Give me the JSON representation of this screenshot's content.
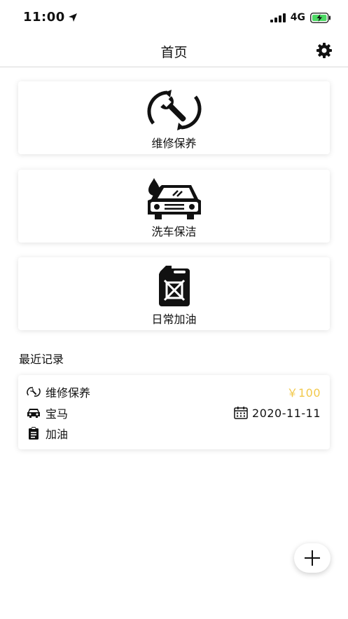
{
  "status_bar": {
    "time": "11:00",
    "network": "4G"
  },
  "nav": {
    "title": "首页",
    "settings_icon": "gear-icon"
  },
  "cards": [
    {
      "label": "维修保养",
      "icon": "wrench-cycle-icon"
    },
    {
      "label": "洗车保洁",
      "icon": "car-wash-icon"
    },
    {
      "label": "日常加油",
      "icon": "fuel-can-icon"
    }
  ],
  "recent": {
    "title": "最近记录",
    "record": {
      "type": "维修保养",
      "price": "￥100",
      "car": "宝马",
      "date": "2020-11-11",
      "note": "加油"
    }
  },
  "colors": {
    "price": "#f2c94c",
    "battery": "#4cd964"
  },
  "fab": {
    "icon": "plus-icon"
  }
}
